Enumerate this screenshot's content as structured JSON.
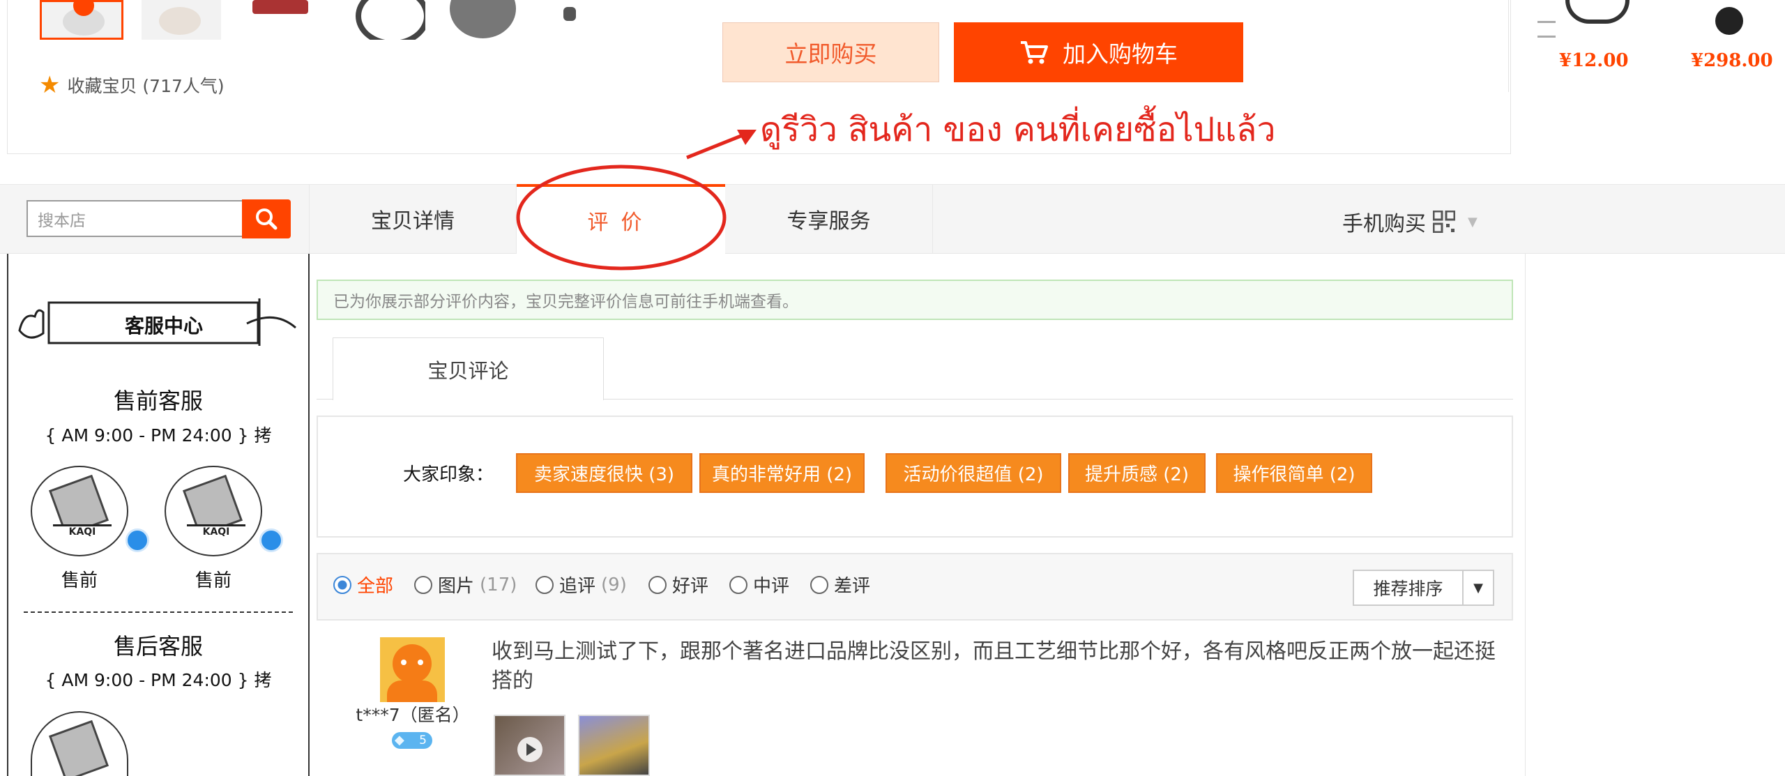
{
  "top": {
    "favorite_label": "收藏宝贝 (717人气)",
    "buy_now": "立即购买",
    "add_to_cart": "加入购物车",
    "recommended_prices": [
      "¥12.00",
      "¥298.00"
    ]
  },
  "annotation": {
    "note": "ดูรีวิว สินค้า ของ คนที่เคยซื้อไปแล้ว",
    "color": "#e3271d"
  },
  "tabbar": {
    "search_placeholder": "搜本店",
    "tabs": [
      "宝贝详情",
      "评价",
      "专享服务"
    ],
    "active_tab": "评价",
    "mobile_buy": "手机购买"
  },
  "sidebar": {
    "center_title": "客服中心",
    "presale_title": "售前客服",
    "presale_hours": "{ AM 9:00 - PM 24:00 } 拷",
    "presale_agents": [
      "售前",
      "售前"
    ],
    "aftersale_title": "售后客服",
    "aftersale_hours": "{ AM 9:00 - PM 24:00 } 拷"
  },
  "reviews": {
    "notice": "已为你展示部分评价内容，宝贝完整评价信息可前往手机端查看。",
    "section_tab": "宝贝评论",
    "impression_label": "大家印象：",
    "tags": [
      "卖家速度很快 (3)",
      "真的非常好用 (2)",
      "活动价很超值 (2)",
      "提升质感 (2)",
      "操作很简单 (2)"
    ],
    "filters": [
      {
        "label": "全部",
        "count": "",
        "selected": true
      },
      {
        "label": "图片",
        "count": "(17)",
        "selected": false
      },
      {
        "label": "追评",
        "count": "(9)",
        "selected": false
      },
      {
        "label": "好评",
        "count": "",
        "selected": false
      },
      {
        "label": "中评",
        "count": "",
        "selected": false
      },
      {
        "label": "差评",
        "count": "",
        "selected": false
      }
    ],
    "sort_label": "推荐排序",
    "first_review": {
      "reviewer": "t***7（匿名）",
      "vip_level": "5",
      "text": "收到马上测试了下，跟那个著名进口品牌比没区别，而且工艺细节比那个好，各有风格吧反正两个放一起还挺搭的"
    }
  },
  "colors": {
    "accent": "#ff4400",
    "tag_orange": "#f68a1e",
    "price": "#f40"
  }
}
